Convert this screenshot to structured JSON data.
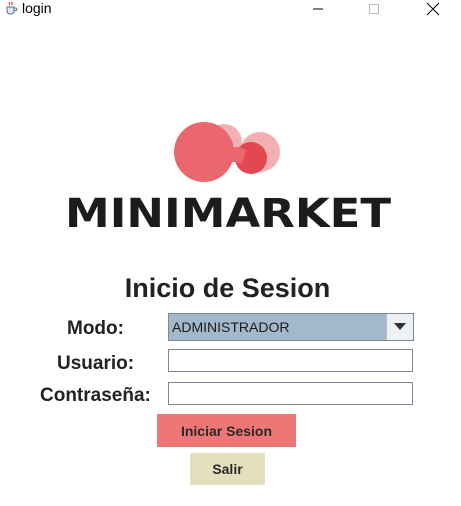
{
  "window": {
    "title": "login",
    "icon": "java-cup-icon",
    "controls": [
      "minimize",
      "maximize",
      "close"
    ]
  },
  "logo": {
    "text": "MINIMARKET",
    "colors": {
      "accent": "#e8575f",
      "accent_light": "#f0a0a4",
      "wordmark": "#1c1c1c"
    }
  },
  "form": {
    "heading": "Inicio de Sesion",
    "mode_label": "Modo:",
    "mode_value": "ADMINISTRADOR",
    "user_label": "Usuario:",
    "user_value": "",
    "password_label": "Contraseña:",
    "password_value": ""
  },
  "buttons": {
    "login": "Iniciar Sesion",
    "exit": "Salir"
  },
  "colors": {
    "login_button": "#ee7676",
    "exit_button": "#e4dfbd",
    "select_bg": "#a3b8cc"
  }
}
